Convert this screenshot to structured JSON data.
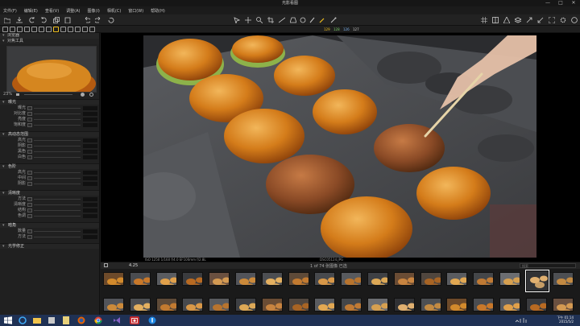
{
  "window": {
    "title": "光影看图",
    "minimize": "—",
    "maximize": "□",
    "close": "✕"
  },
  "menu": [
    "文件(F)",
    "编辑(E)",
    "查看(V)",
    "调整(A)",
    "图像(I)",
    "相机(C)",
    "窗口(W)",
    "帮助(H)"
  ],
  "toolbar_readout": {
    "r": "129",
    "g": "128",
    "b": "126",
    "l": "127"
  },
  "left_panel": {
    "navigator_title": "浏览器",
    "navigator_sub": "对焦工具",
    "zoom_label": "23%",
    "sections": [
      {
        "title": "曝光",
        "rows": [
          "曝光",
          "对比度",
          "亮度",
          "饱和度"
        ]
      },
      {
        "title": "高动态范围",
        "rows": [
          "高光",
          "阴影",
          "黑色",
          "白色"
        ]
      },
      {
        "title": "色阶",
        "rows": [
          "高光",
          "中间",
          "阴影"
        ]
      },
      {
        "title": "清晰度",
        "rows": [
          "方法",
          "清晰度",
          "结构",
          "色调"
        ]
      },
      {
        "title": "暗角",
        "rows": [
          "数量",
          "方法"
        ]
      },
      {
        "title": "光学修正",
        "rows": []
      }
    ]
  },
  "viewer": {
    "caption_left": "ISO 1250   1/160   f/4.0   EF100mm f/2.8L",
    "caption_right": "DSC05124.JPG"
  },
  "filmstrip": {
    "zoom": "4.25",
    "counter": "1 of 74 张图像 已选",
    "search_placeholder": "搜索"
  },
  "taskbar": {
    "time": "下午 01:14",
    "date": "2015/5/2"
  },
  "colors": {
    "accent": "#f0c020",
    "taskbar": "#1f3154"
  },
  "icons": [
    "windows-icon",
    "ie-icon",
    "explorer-icon",
    "firefox-icon",
    "chrome-icon",
    "vs-icon",
    "app-icon",
    "info-icon"
  ]
}
